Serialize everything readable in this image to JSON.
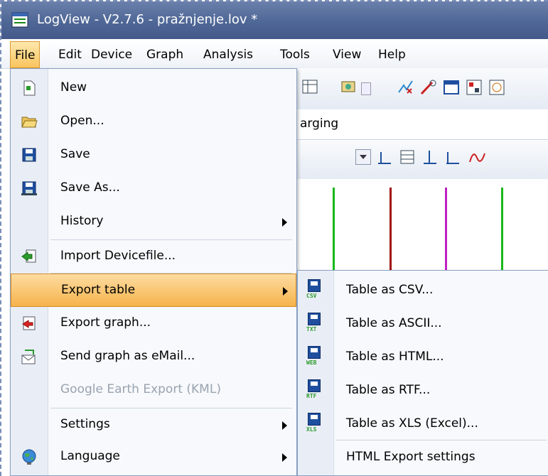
{
  "window": {
    "title": "LogView - V2.7.6 - pražnjenje.lov *"
  },
  "menubar": {
    "items": [
      {
        "label": "File"
      },
      {
        "label": "Edit"
      },
      {
        "label": "Device"
      },
      {
        "label": "Graph"
      },
      {
        "label": "Analysis"
      },
      {
        "label": "Tools"
      },
      {
        "label": "View"
      },
      {
        "label": "Help"
      }
    ]
  },
  "background": {
    "combo_text": "arging"
  },
  "file_menu": {
    "items": [
      {
        "label": "New",
        "icon": "new-file-icon"
      },
      {
        "label": "Open...",
        "icon": "open-folder-icon"
      },
      {
        "label": "Save",
        "icon": "floppy-disk-icon"
      },
      {
        "label": "Save As...",
        "icon": "floppy-disk-icon"
      },
      {
        "label": "History"
      },
      {
        "label": "Import Devicefile...",
        "icon": "import-icon"
      },
      {
        "label": "Export table"
      },
      {
        "label": "Export graph...",
        "icon": "export-graph-icon"
      },
      {
        "label": "Send graph as eMail...",
        "icon": "email-icon"
      },
      {
        "label": "Google Earth Export (KML)"
      },
      {
        "label": "Settings"
      },
      {
        "label": "Language",
        "icon": "globe-icon"
      }
    ]
  },
  "export_submenu": {
    "items": [
      {
        "label": "Table as CSV...",
        "tag": "CSV"
      },
      {
        "label": "Table as ASCII...",
        "tag": "TXT"
      },
      {
        "label": "Table as HTML...",
        "tag": "WEB"
      },
      {
        "label": "Table as RTF...",
        "tag": "RTF"
      },
      {
        "label": "Table as XLS (Excel)...",
        "tag": "XLS"
      },
      {
        "label": "HTML Export settings"
      }
    ]
  },
  "colors": {
    "accent": "#f6b34b",
    "title_bar": "#4f6796",
    "green_line": "#18b818",
    "red_line": "#a01010",
    "magenta_line": "#c020c0"
  }
}
